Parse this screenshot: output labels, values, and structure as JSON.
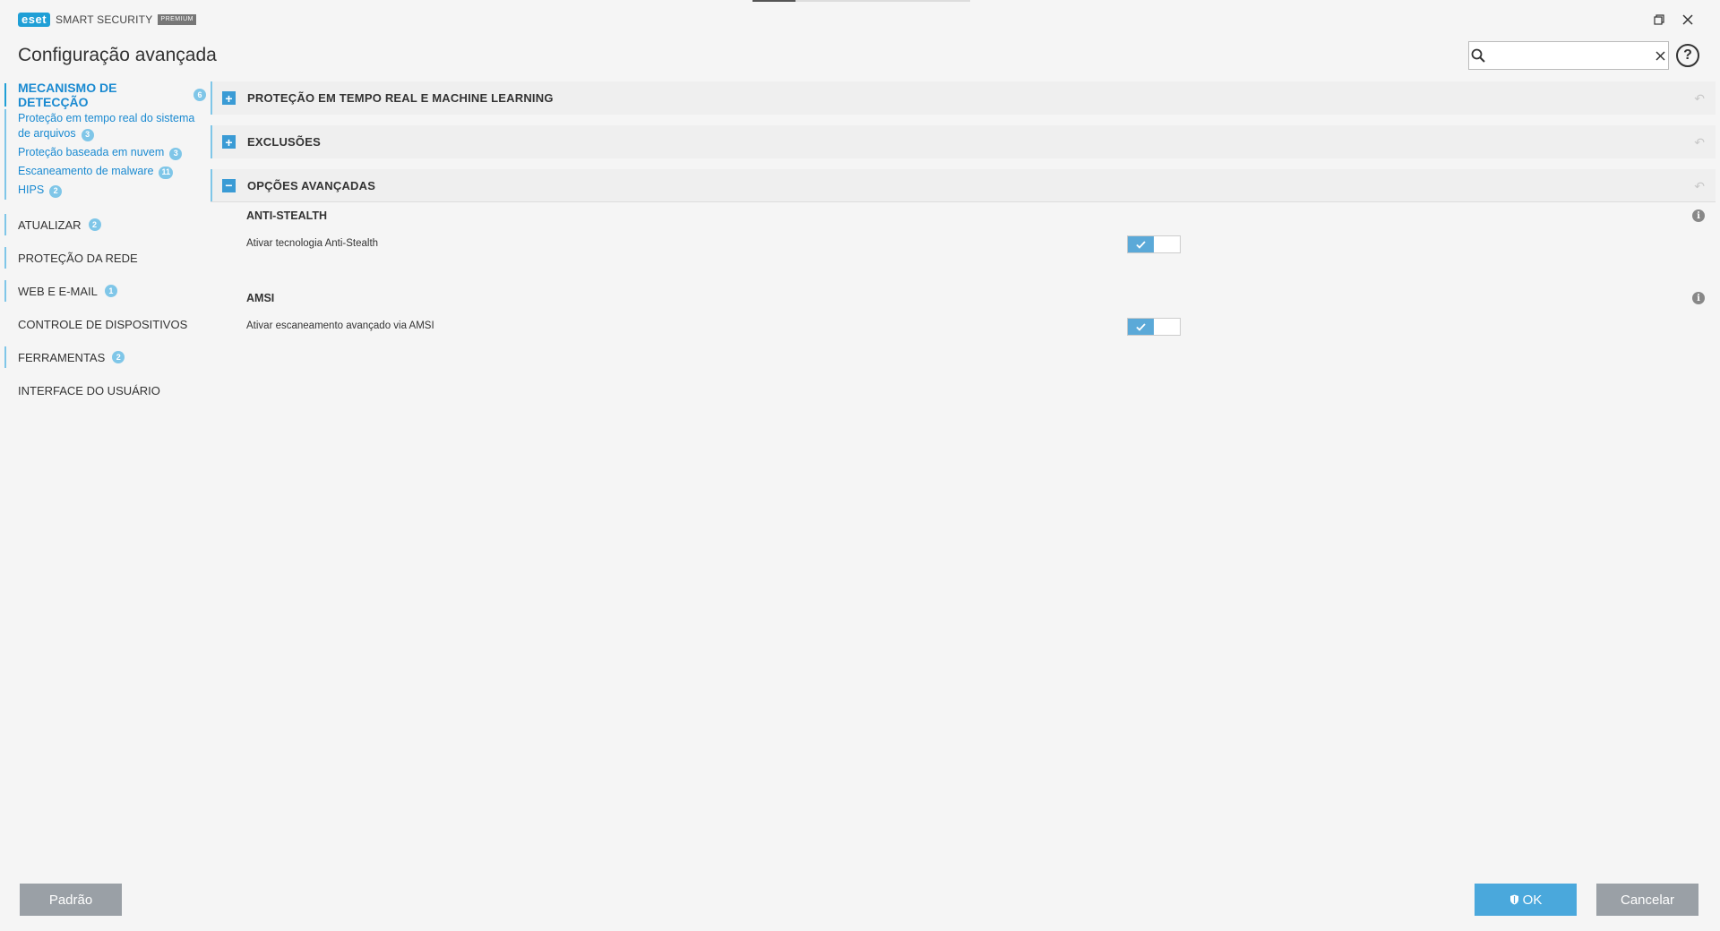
{
  "app": {
    "brand": "eset",
    "product": "SMART SECURITY",
    "edition": "PREMIUM"
  },
  "page_title": "Configuração avançada",
  "search": {
    "value": "",
    "placeholder": ""
  },
  "sidebar": {
    "items": [
      {
        "label": "MECANISMO DE DETECÇÃO",
        "badge": "6",
        "active": true,
        "subitems": [
          {
            "label": "Proteção em tempo real do sistema de arquivos",
            "badge": "3"
          },
          {
            "label": "Proteção baseada em nuvem",
            "badge": "3"
          },
          {
            "label": "Escaneamento de malware",
            "badge": "11"
          },
          {
            "label": "HIPS",
            "badge": "2"
          }
        ]
      },
      {
        "label": "ATUALIZAR",
        "badge": "2"
      },
      {
        "label": "PROTEÇÃO DA REDE",
        "badge": ""
      },
      {
        "label": "WEB E E-MAIL",
        "badge": "1"
      },
      {
        "label": "CONTROLE DE DISPOSITIVOS",
        "badge": ""
      },
      {
        "label": "FERRAMENTAS",
        "badge": "2"
      },
      {
        "label": "INTERFACE DO USUÁRIO",
        "badge": ""
      }
    ]
  },
  "sections": [
    {
      "title": "PROTEÇÃO EM TEMPO REAL E MACHINE LEARNING",
      "expanded": false
    },
    {
      "title": "EXCLUSÕES",
      "expanded": false
    },
    {
      "title": "OPÇÕES AVANÇADAS",
      "expanded": true,
      "subsections": [
        {
          "title": "ANTI-STEALTH",
          "options": [
            {
              "label": "Ativar tecnologia Anti-Stealth",
              "enabled": true
            }
          ]
        },
        {
          "title": "AMSI",
          "options": [
            {
              "label": "Ativar escaneamento avançado via AMSI",
              "enabled": true
            }
          ]
        }
      ]
    }
  ],
  "footer": {
    "default_label": "Padrão",
    "ok_label": "OK",
    "cancel_label": "Cancelar"
  },
  "colors": {
    "accent": "#1f9fd6",
    "badge": "#7fc6e8",
    "toggle_on": "#5ba9d8",
    "button_gray": "#9aa0a6",
    "button_ok": "#4aa8dc"
  }
}
